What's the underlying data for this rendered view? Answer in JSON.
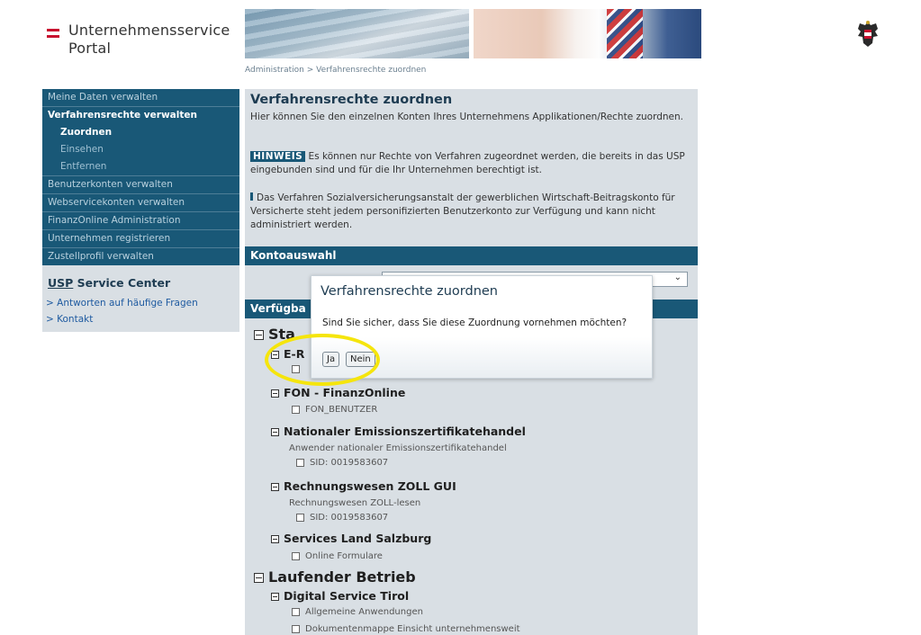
{
  "header": {
    "logo_line1": "Unternehmensservice",
    "logo_line2": "Portal",
    "brand_color": "#c8102e",
    "crest_icon": "austrian-eagle-crest-icon",
    "breadcrumb": "Administration > Verfahrensrechte zuordnen"
  },
  "sidebar": {
    "items": [
      {
        "label": "Meine Daten verwalten"
      },
      {
        "label": "Verfahrensrechte verwalten"
      },
      {
        "label": "Zuordnen"
      },
      {
        "label": "Einsehen"
      },
      {
        "label": "Entfernen"
      },
      {
        "label": "Benutzerkonten verwalten"
      },
      {
        "label": "Webservicekonten verwalten"
      },
      {
        "label": "FinanzOnline Administration"
      },
      {
        "label": "Unternehmen registrieren"
      },
      {
        "label": "Zustellprofil verwalten"
      }
    ],
    "service_center": {
      "title_abbr": "USP",
      "title_rest": " Service Center",
      "links": [
        "> Antworten auf häufige Fragen",
        "> Kontakt"
      ]
    },
    "nav_color": "#195877"
  },
  "main": {
    "title": "Verfahrensrechte zuordnen",
    "intro": "Hier können Sie den einzelnen Konten Ihres Unternehmens Applikationen/Rechte zuordnen.",
    "hinweis_tag": "HINWEIS",
    "hinweis_text": " Es können nur Rechte von Verfahren zugeordnet werden, die bereits in das USP eingebunden sind und für die Ihr Unternehmen berechtigt ist.",
    "notice": "Das Verfahren Sozialversicherungsanstalt der gewerblichen Wirtschaft-Beitragskonto für Versicherte steht jedem personifizierten Benutzerkonto zur Verfügung und kann nicht administriert werden.",
    "kontoauswahl_label": "Kontoauswahl",
    "select_value": "",
    "verfuegbar_label": "Verfügba",
    "tree": {
      "group1_label": "Sta",
      "proc1_label": "E-R",
      "proc2_label": "FON - FinanzOnline",
      "proc2_cb": "FON_BENUTZER",
      "proc3_label": "Nationaler Emissionszertifikatehandel",
      "proc3_desc": "Anwender nationaler Emissionszertifikatehandel",
      "proc3_cb": "SID: 0019583607",
      "proc4_label": "Rechnungswesen ZOLL GUI",
      "proc4_desc": "Rechnungswesen ZOLL-lesen",
      "proc4_cb": "SID: 0019583607",
      "proc5_label": "Services Land Salzburg",
      "proc5_cb": "Online Formulare",
      "group2_label": "Laufender Betrieb",
      "proc6_label": "Digital Service Tirol",
      "proc6_cb1": "Allgemeine Anwendungen",
      "proc6_cb2": "Dokumentenmappe Einsicht unternehmensweit"
    }
  },
  "dialog": {
    "title": "Verfahrensrechte zuordnen",
    "message": "Sind Sie sicher, dass Sie diese Zuordnung vornehmen möchten?",
    "yes_label": "Ja",
    "no_label": "Nein",
    "highlight_color": "#f5e50c"
  }
}
